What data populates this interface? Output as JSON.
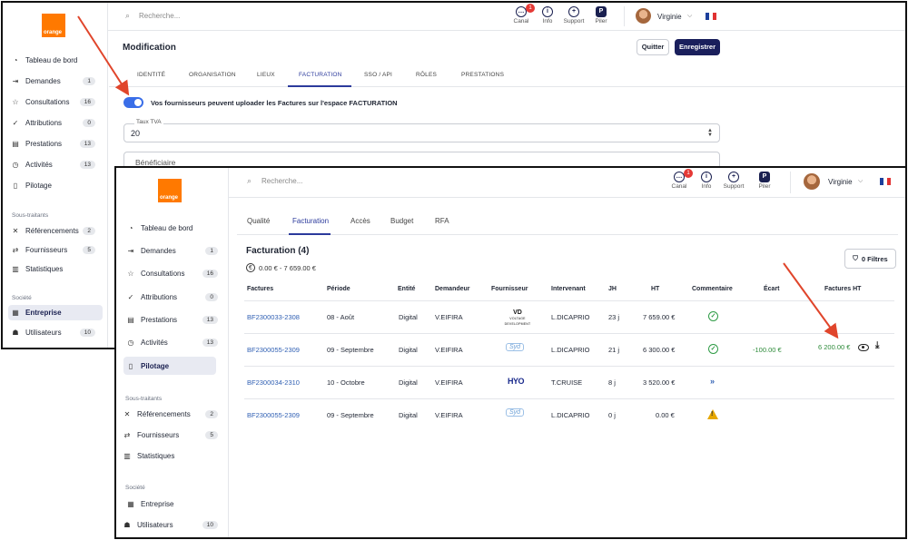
{
  "common": {
    "search_placeholder": "Recherche...",
    "toolbar": {
      "canal_label": "Canal",
      "canal_badge": "1",
      "info_label": "Info",
      "support_label": "Support",
      "piler_label": "Piler"
    },
    "user_name": "Virginie",
    "logo_text": "orange"
  },
  "sidebar": {
    "items": [
      {
        "label": "Tableau de bord",
        "icon": "dashboard-icon"
      },
      {
        "label": "Demandes",
        "badge": "1",
        "icon": "requests-icon"
      },
      {
        "label": "Consultations",
        "badge": "16",
        "icon": "star-icon"
      },
      {
        "label": "Attributions",
        "badge": "0",
        "icon": "check-icon"
      },
      {
        "label": "Prestations",
        "badge": "13",
        "icon": "document-icon"
      },
      {
        "label": "Activités",
        "badge": "13",
        "icon": "clock-icon"
      },
      {
        "label": "Pilotage",
        "icon": "file-icon"
      }
    ],
    "section_subcontractors": "Sous-traitants",
    "sub_items": [
      {
        "label": "Référencements",
        "badge": "2",
        "icon": "network-icon"
      },
      {
        "label": "Fournisseurs",
        "badge": "5",
        "icon": "handshake-icon"
      },
      {
        "label": "Statistiques",
        "icon": "stats-icon"
      }
    ],
    "section_company": "Société",
    "company_items": [
      {
        "label": "Entreprise",
        "icon": "building-icon"
      },
      {
        "label": "Utilisateurs",
        "badge": "10",
        "icon": "users-icon"
      }
    ]
  },
  "window_a": {
    "page_title": "Modification",
    "quit_label": "Quitter",
    "save_label": "Enregistrer",
    "tabs": [
      "IDENTITÉ",
      "ORGANISATION",
      "LIEUX",
      "FACTURATION",
      "SSO / API",
      "RÔLES",
      "PRESTATIONS"
    ],
    "active_tab": "FACTURATION",
    "toggle_label": "Vos fournisseurs peuvent uploader les Factures sur l'espace FACTURATION",
    "toggle_on": true,
    "tva_label": "Taux TVA",
    "tva_value": "20",
    "beneficiary_placeholder": "Bénéficiaire"
  },
  "window_b": {
    "tabs": [
      "Qualité",
      "Facturation",
      "Accès",
      "Budget",
      "RFA"
    ],
    "active_tab": "Facturation",
    "section_title": "Facturation (4)",
    "amount_range": "0.00 € - 7 659.00 €",
    "filters_label": "0 Filtres",
    "table": {
      "headers": [
        "Factures",
        "Période",
        "Entité",
        "Demandeur",
        "Fournisseur",
        "Intervenant",
        "JH",
        "HT",
        "Commentaire",
        "Écart",
        "Factures HT"
      ],
      "rows": [
        {
          "invoice": "BF2300033-2308",
          "period": "08 - Août",
          "entity": "Digital",
          "requester": "V.EIFIRA",
          "supplier": "VD",
          "supplier_sub": "VOLTAGE DEVELOPMENT",
          "contractor": "L.DICAPRIO",
          "days": "23 j",
          "ht": "7 659.00 €",
          "comment": "check-circle-icon",
          "gap": "",
          "invoice_ht": ""
        },
        {
          "invoice": "BF2300055-2309",
          "period": "09 - Septembre",
          "entity": "Digital",
          "requester": "V.EIFIRA",
          "supplier": "Syd",
          "supplier_sub": "",
          "contractor": "L.DICAPRIO",
          "days": "21 j",
          "ht": "6 300.00 €",
          "comment": "check-circle-icon",
          "gap": "-100.00 €",
          "invoice_ht": "6 200.00 €"
        },
        {
          "invoice": "BF2300034-2310",
          "period": "10 - Octobre",
          "entity": "Digital",
          "requester": "V.EIFIRA",
          "supplier": "HYO",
          "supplier_sub": "",
          "contractor": "T.CRUISE",
          "days": "8 j",
          "ht": "3 520.00 €",
          "comment": "chevron-right-icon",
          "gap": "",
          "invoice_ht": ""
        },
        {
          "invoice": "BF2300055-2309",
          "period": "09 - Septembre",
          "entity": "Digital",
          "requester": "V.EIFIRA",
          "supplier": "Syd",
          "supplier_sub": "",
          "contractor": "L.DICAPRIO",
          "days": "0 j",
          "ht": "0.00 €",
          "comment": "warning-icon",
          "gap": "",
          "invoice_ht": ""
        }
      ]
    }
  },
  "colors": {
    "brand_orange": "#ff7900",
    "primary_navy": "#1a1f5c",
    "accent_blue": "#2b3a9c",
    "link_blue": "#2f5fb3",
    "success_green": "#2e8b3a",
    "warning_yellow": "#e6a700",
    "annotation_red": "#e0452b"
  }
}
